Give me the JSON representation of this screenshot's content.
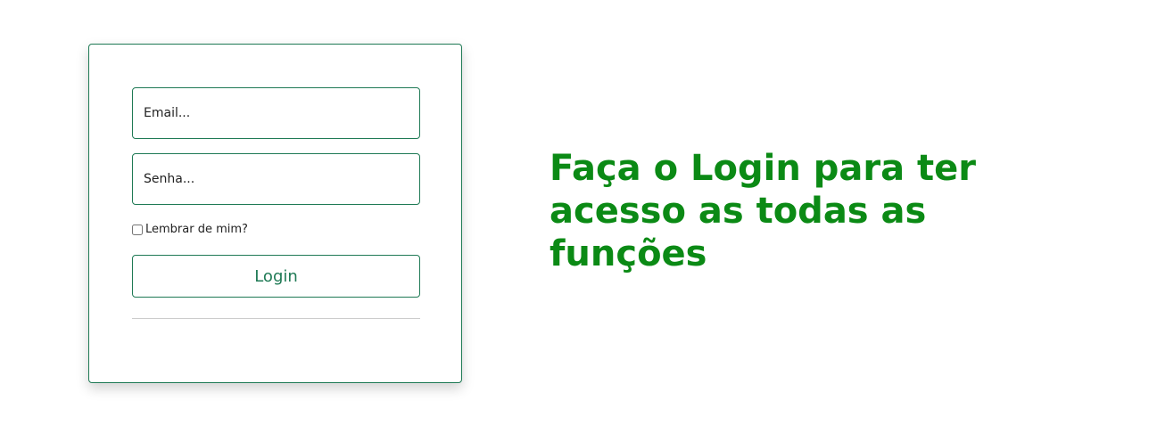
{
  "login_form": {
    "email_placeholder": "Email...",
    "password_placeholder": "Senha...",
    "remember_label": "Lembrar de mim?",
    "remember_checked": false,
    "login_button_label": "Login"
  },
  "headline": "Faça o Login para ter acesso as todas as funções",
  "colors": {
    "accent_border": "#1f7a55",
    "headline": "#0b8a15",
    "divider": "#cccccc"
  }
}
